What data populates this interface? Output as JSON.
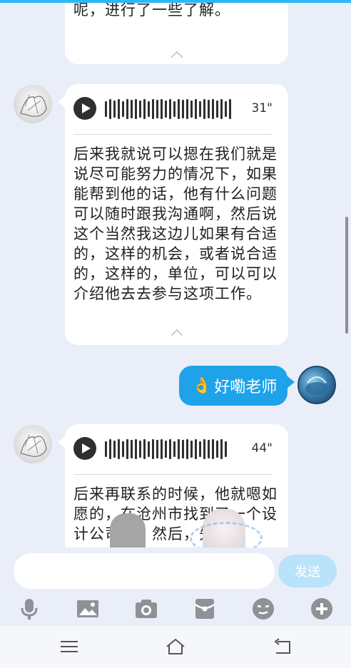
{
  "messages": {
    "partial": {
      "text": "毕业设计的一一些这个作品呢，进行了一些了解。"
    },
    "voice1": {
      "duration": "31\"",
      "transcript": "后来我就说可以摁在我们就是说尽可能努力的情况下，如果能帮到他的话，他有什么问题可以随时跟我沟通啊，然后说这个当然我这边儿如果有合适的，这样的机会，或者说合适的，这样的，单位，可以可以介绍他去去参与这项工作。"
    },
    "outgoing": {
      "emoji": "👌",
      "text": "好嘞老师"
    },
    "voice2": {
      "duration": "44\"",
      "transcript": "后来再联系的时候，他就嗯如愿的，在沧州市找到了一个设计公司啊，然后，先"
    }
  },
  "composer": {
    "input_value": "",
    "send_label": "发送"
  },
  "toolbar": {
    "icons": [
      "microphone-icon",
      "image-icon",
      "camera-icon",
      "red-packet-icon",
      "emoji-icon",
      "plus-icon"
    ]
  },
  "navigation": {
    "icons": [
      "menu-icon",
      "home-icon",
      "back-icon"
    ]
  },
  "colors": {
    "accent": "#1ea3ea",
    "send_disabled": "#b9e3fb",
    "background": "#e9eef8",
    "icon_gray": "#8e9196"
  }
}
